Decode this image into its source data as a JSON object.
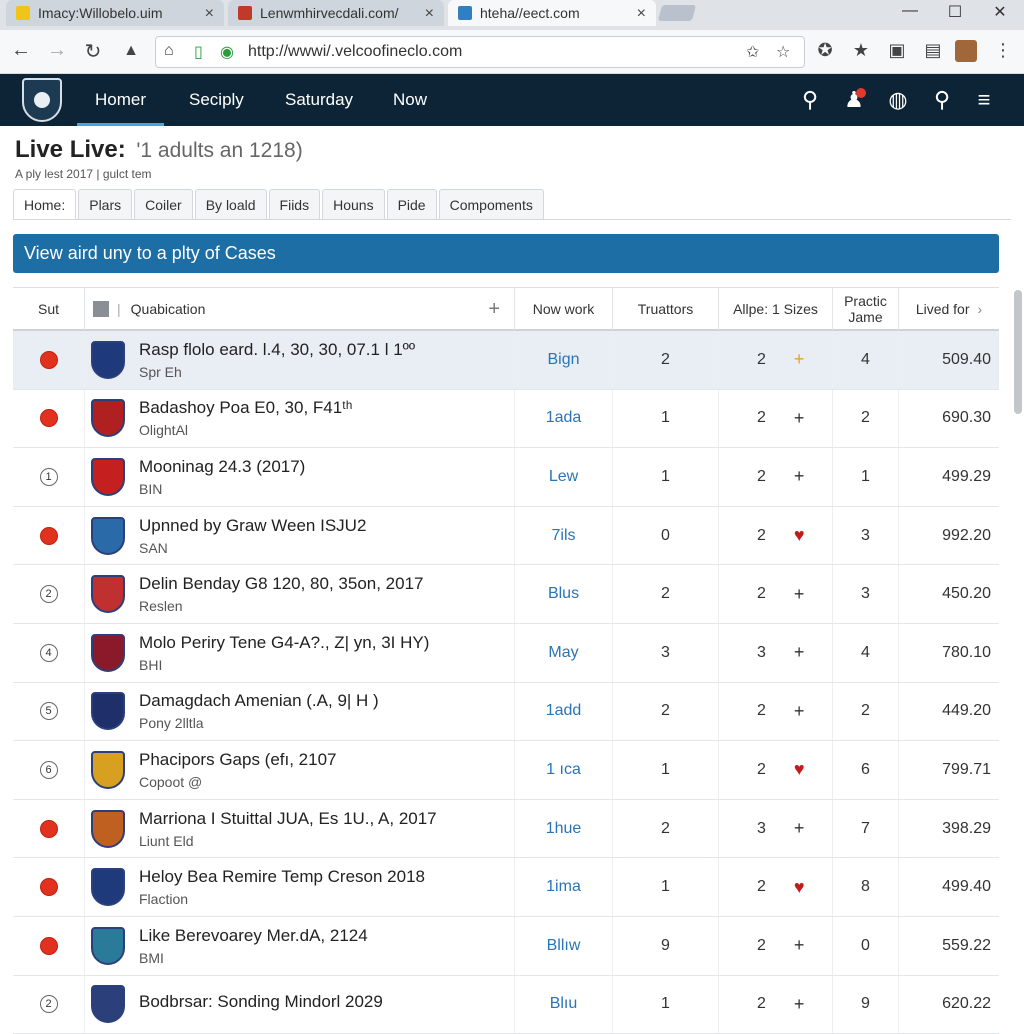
{
  "browser": {
    "tabs": [
      {
        "title": "Imacy:Willobelo.uim",
        "close": "×"
      },
      {
        "title": "Lenwmhirvecdali.com/",
        "close": "×"
      },
      {
        "title": "hteha//eect.com",
        "close": "×"
      }
    ],
    "window_controls": {
      "minimize": "—",
      "maximize": "☐",
      "close": "✕"
    },
    "url": "http://wwwi/.velcoofineclo.com"
  },
  "header": {
    "nav": [
      "Homer",
      "Seciply",
      "Saturday",
      "Now"
    ]
  },
  "page": {
    "title": "Live Live:",
    "title_extra": "'1 adults  an  1218)",
    "subtitle": "A ply lest 2017 | gulct tem",
    "tabs": [
      "Home:",
      "Plars",
      "Coiler",
      "By loald",
      "Fiids",
      "Houns",
      "Pide",
      "Compoments"
    ],
    "banner": "View aird uny to a plty of Cases"
  },
  "table": {
    "columns": [
      "Sut",
      "Quabication",
      "Now work",
      "Truattors",
      "Allpe: 1 Sizes",
      "Practic Jame",
      "Lived for"
    ],
    "rows": [
      {
        "rank": "",
        "name": "Rasp flolo eard. l.4, 30, 30, 07.1 l 1ºº",
        "sub": "Spr Eh",
        "work": "Bign",
        "tr": "2",
        "al": "2",
        "mark": "+",
        "pr": "4",
        "lived": "509.40"
      },
      {
        "rank": "",
        "name": "Badashoy Poa E0, 30, F41ᵗʰ",
        "sub": "OlightAl",
        "work": "1ada",
        "tr": "1",
        "al": "2",
        "mark": "+",
        "pr": "2",
        "lived": "690.30"
      },
      {
        "rank": "1",
        "name": "Mooninag 24.3 (2017)",
        "sub": "BIN",
        "work": "Lew",
        "tr": "1",
        "al": "2",
        "mark": "+",
        "pr": "1",
        "lived": "499.29"
      },
      {
        "rank": "",
        "name": "Upnned by Graw Ween ISJU2",
        "sub": "SAN",
        "work": "7ils",
        "tr": "0",
        "al": "2",
        "mark": "♥",
        "pr": "3",
        "lived": "992.20"
      },
      {
        "rank": "2",
        "name": "Delin Benday G8 120, 80, 35on, 2017",
        "sub": "Reslen",
        "work": "Blus",
        "tr": "2",
        "al": "2",
        "mark": "+",
        "pr": "3",
        "lived": "450.20"
      },
      {
        "rank": "4",
        "name": "Molo Periry Tene G4-A?., Z| yn, 3I HY)",
        "sub": "BHI",
        "work": "May",
        "tr": "3",
        "al": "3",
        "mark": "+",
        "pr": "4",
        "lived": "780.10"
      },
      {
        "rank": "5",
        "name": "Damagdach Amenian (.A, 9| H )",
        "sub": "Pony 2lltla",
        "work": "1add",
        "tr": "2",
        "al": "2",
        "mark": "+",
        "pr": "2",
        "lived": "449.20"
      },
      {
        "rank": "6",
        "name": "Phacipors Gaps (efı, 2107",
        "sub": "Copoot @",
        "work": "1 ıca",
        "tr": "1",
        "al": "2",
        "mark": "♥",
        "pr": "6",
        "lived": "799.71"
      },
      {
        "rank": "",
        "name": "Marriona I Stuittal JUA, Es 1U., A, 2017",
        "sub": "Liunt Eld",
        "work": "1hue",
        "tr": "2",
        "al": "3",
        "mark": "+",
        "pr": "7",
        "lived": "398.29"
      },
      {
        "rank": "",
        "name": "Heloy Bea Remire Temp Creson 2018",
        "sub": "Flaction",
        "work": "1ima",
        "tr": "1",
        "al": "2",
        "mark": "♥",
        "pr": "8",
        "lived": "499.40"
      },
      {
        "rank": "",
        "name": "Like Berevoarey Mer.dA, 2124",
        "sub": "BMI",
        "work": "Bllıw",
        "tr": "9",
        "al": "2",
        "mark": "+",
        "pr": "0",
        "lived": "559.22"
      },
      {
        "rank": "2",
        "name": "Bodbrsar: Sonding Mindorl 2029",
        "sub": "",
        "work": "Blıu",
        "tr": "1",
        "al": "2",
        "mark": "+",
        "pr": "9",
        "lived": "620.22"
      }
    ]
  },
  "colors": {
    "header_bg": "#0c2436",
    "banner_bg": "#1c6ea4",
    "link": "#2a74b8",
    "heart": "#c41a1a",
    "accent_plus": "#f0a020"
  }
}
